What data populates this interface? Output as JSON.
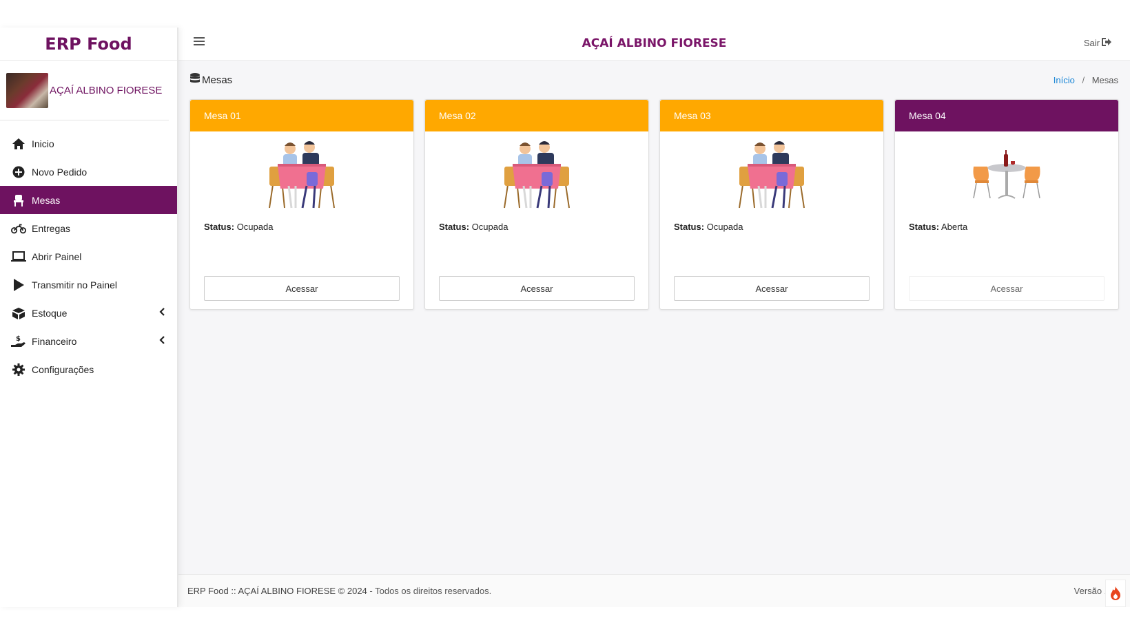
{
  "brand": "ERP Food",
  "user": {
    "name": "AÇAÍ ALBINO FIORESE"
  },
  "menu": [
    {
      "label": "Inicio",
      "icon": "home-icon"
    },
    {
      "label": "Novo Pedido",
      "icon": "plus-circle-icon"
    },
    {
      "label": "Mesas",
      "icon": "chair-icon",
      "active": true
    },
    {
      "label": "Entregas",
      "icon": "motorcycle-icon"
    },
    {
      "label": "Abrir Painel",
      "icon": "laptop-icon"
    },
    {
      "label": "Transmitir no Painel",
      "icon": "play-icon"
    },
    {
      "label": "Estoque",
      "icon": "boxes-icon",
      "submenu": true
    },
    {
      "label": "Financeiro",
      "icon": "hand-dollar-icon",
      "submenu": true
    },
    {
      "label": "Configurações",
      "icon": "gear-icon"
    }
  ],
  "topbar": {
    "title": "AÇAÍ ALBINO FIORESE",
    "logout": "Sair"
  },
  "page": {
    "title": "Mesas"
  },
  "breadcrumb": {
    "home": "Início",
    "sep": "/",
    "current": "Mesas"
  },
  "tables": [
    {
      "name": "Mesa 01",
      "status_label": "Status:",
      "status": "Ocupada",
      "button": "Acessar",
      "color": "#FFA800"
    },
    {
      "name": "Mesa 02",
      "status_label": "Status:",
      "status": "Ocupada",
      "button": "Acessar",
      "color": "#FFA800"
    },
    {
      "name": "Mesa 03",
      "status_label": "Status:",
      "status": "Ocupada",
      "button": "Acessar",
      "color": "#FFA800"
    },
    {
      "name": "Mesa 04",
      "status_label": "Status:",
      "status": "Aberta",
      "button": "Acessar",
      "color": "#6E1260"
    }
  ],
  "footer": {
    "copyright": "ERP Food :: AÇAÍ ALBINO FIORESE © 2024",
    "rights": " - Todos os direitos reservados.",
    "version": "Versão 1"
  },
  "colors": {
    "brand": "#6E1260",
    "occupied": "#FFA800",
    "link": "#1A86D6"
  }
}
